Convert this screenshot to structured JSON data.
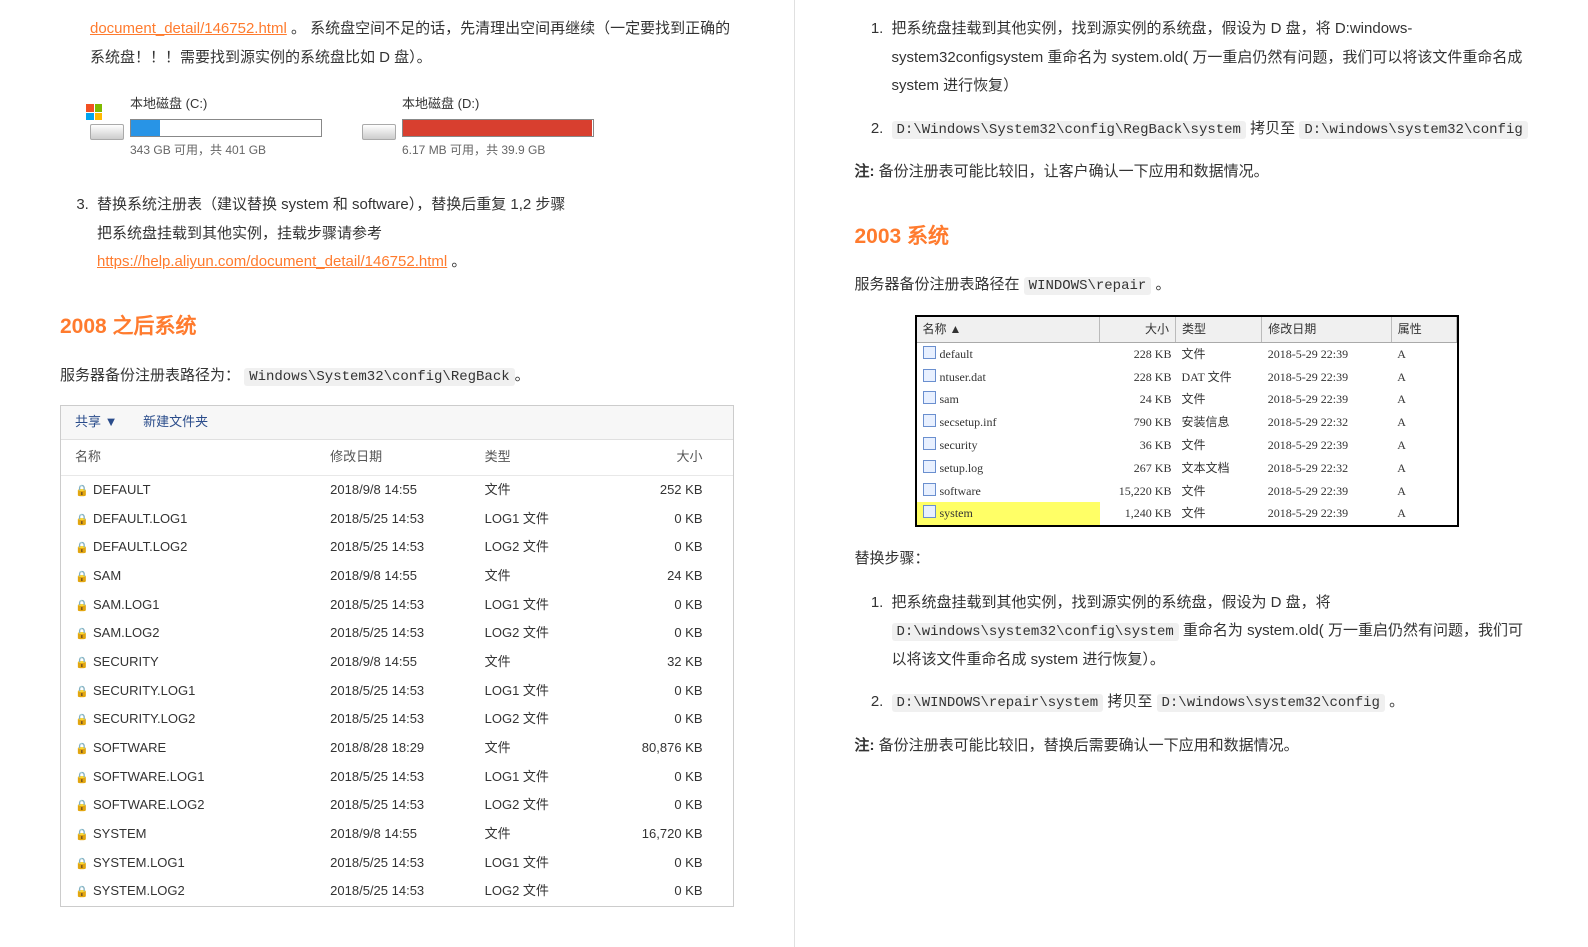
{
  "left": {
    "top_link": "document_detail/146752.html",
    "top_after": "。 系统盘空间不足的话，先清理出空间再继续（一定要找到正确的系统盘！！！需要找到源实例的系统盘比如 D 盘）。",
    "disks": {
      "c_label": "本地磁盘 (C:)",
      "c_free": "343 GB 可用，共 401 GB",
      "d_label": "本地磁盘 (D:)",
      "d_free": "6.17 MB 可用，共 39.9 GB"
    },
    "step3_a": "替换系统注册表（建议替换 system 和 software），替换后重复 1,2 步骤",
    "step3_b": "把系统盘挂载到其他实例，挂载步骤请参考 ",
    "step3_link": "https://help.aliyun.com/document_detail/146752.html",
    "step3_c": "。",
    "h_2008": "2008 之后系统",
    "p_2008": "服务器备份注册表路径为：",
    "code_2008": "Windows\\System32\\config\\RegBack",
    "toolbar_share": "共享 ▼",
    "toolbar_new": "新建文件夹",
    "th": {
      "name": "名称",
      "mdate": "修改日期",
      "type": "类型",
      "size": "大小"
    },
    "rows": [
      {
        "n": "DEFAULT",
        "d": "2018/9/8 14:55",
        "t": "文件",
        "s": "252 KB"
      },
      {
        "n": "DEFAULT.LOG1",
        "d": "2018/5/25 14:53",
        "t": "LOG1 文件",
        "s": "0 KB"
      },
      {
        "n": "DEFAULT.LOG2",
        "d": "2018/5/25 14:53",
        "t": "LOG2 文件",
        "s": "0 KB"
      },
      {
        "n": "SAM",
        "d": "2018/9/8 14:55",
        "t": "文件",
        "s": "24 KB"
      },
      {
        "n": "SAM.LOG1",
        "d": "2018/5/25 14:53",
        "t": "LOG1 文件",
        "s": "0 KB"
      },
      {
        "n": "SAM.LOG2",
        "d": "2018/5/25 14:53",
        "t": "LOG2 文件",
        "s": "0 KB"
      },
      {
        "n": "SECURITY",
        "d": "2018/9/8 14:55",
        "t": "文件",
        "s": "32 KB"
      },
      {
        "n": "SECURITY.LOG1",
        "d": "2018/5/25 14:53",
        "t": "LOG1 文件",
        "s": "0 KB"
      },
      {
        "n": "SECURITY.LOG2",
        "d": "2018/5/25 14:53",
        "t": "LOG2 文件",
        "s": "0 KB"
      },
      {
        "n": "SOFTWARE",
        "d": "2018/8/28 18:29",
        "t": "文件",
        "s": "80,876 KB"
      },
      {
        "n": "SOFTWARE.LOG1",
        "d": "2018/5/25 14:53",
        "t": "LOG1 文件",
        "s": "0 KB"
      },
      {
        "n": "SOFTWARE.LOG2",
        "d": "2018/5/25 14:53",
        "t": "LOG2 文件",
        "s": "0 KB"
      },
      {
        "n": "SYSTEM",
        "d": "2018/9/8 14:55",
        "t": "文件",
        "s": "16,720 KB"
      },
      {
        "n": "SYSTEM.LOG1",
        "d": "2018/5/25 14:53",
        "t": "LOG1 文件",
        "s": "0 KB"
      },
      {
        "n": "SYSTEM.LOG2",
        "d": "2018/5/25 14:53",
        "t": "LOG2 文件",
        "s": "0 KB"
      }
    ]
  },
  "right": {
    "step1": "把系统盘挂载到其他实例，找到源实例的系统盘，假设为 D 盘，将 D:windows-system32configsystem 重命名为 system.old( 万一重启仍然有问题，我们可以将该文件重命名成 system 进行恢复）",
    "step2_a": "D:\\Windows\\System32\\config\\RegBack\\system",
    "step2_b": "拷贝至",
    "step2_c": "D:\\windows\\system32\\config",
    "note1": "注:",
    "note1_text": "备份注册表可能比较旧，让客户确认一下应用和数据情况。",
    "h_2003": "2003 系统",
    "p_2003_a": "服务器备份注册表路径在 ",
    "code_2003": "WINDOWS\\repair",
    "p_2003_b": "。",
    "th": {
      "name": "名称 ▲",
      "size": "大小",
      "type": "类型",
      "mdate": "修改日期",
      "attr": "属性"
    },
    "rows": [
      {
        "n": "default",
        "s": "228 KB",
        "t": "文件",
        "d": "2018-5-29 22:39",
        "a": "A",
        "hl": false
      },
      {
        "n": "ntuser.dat",
        "s": "228 KB",
        "t": "DAT 文件",
        "d": "2018-5-29 22:39",
        "a": "A",
        "hl": false
      },
      {
        "n": "sam",
        "s": "24 KB",
        "t": "文件",
        "d": "2018-5-29 22:39",
        "a": "A",
        "hl": false
      },
      {
        "n": "secsetup.inf",
        "s": "790 KB",
        "t": "安装信息",
        "d": "2018-5-29 22:32",
        "a": "A",
        "hl": false
      },
      {
        "n": "security",
        "s": "36 KB",
        "t": "文件",
        "d": "2018-5-29 22:39",
        "a": "A",
        "hl": false
      },
      {
        "n": "setup.log",
        "s": "267 KB",
        "t": "文本文档",
        "d": "2018-5-29 22:32",
        "a": "A",
        "hl": false
      },
      {
        "n": "software",
        "s": "15,220 KB",
        "t": "文件",
        "d": "2018-5-29 22:39",
        "a": "A",
        "hl": false
      },
      {
        "n": "system",
        "s": "1,240 KB",
        "t": "文件",
        "d": "2018-5-29 22:39",
        "a": "A",
        "hl": true
      }
    ],
    "replace_title": "替换步骤：",
    "r_step1_a": "把系统盘挂载到其他实例，找到源实例的系统盘，假设为 D 盘，将",
    "r_step1_code": "D:\\windows\\system32\\config\\system",
    "r_step1_b": "重命名为 system.old( 万一重启仍然有问题，我们可以将该文件重命名成 system 进行恢复）。",
    "r_step2_code1": "D:\\WINDOWS\\repair\\system",
    "r_step2_mid": "拷贝至",
    "r_step2_code2": "D:\\windows\\system32\\config",
    "r_step2_end": "。",
    "note2": "注:",
    "note2_text": "备份注册表可能比较旧，替换后需要确认一下应用和数据情况。"
  }
}
